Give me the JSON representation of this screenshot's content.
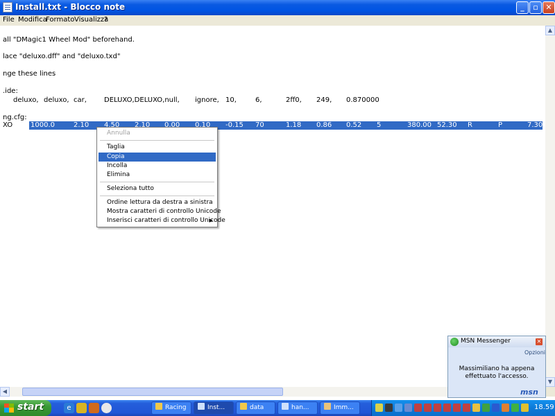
{
  "window": {
    "title": "Install.txt - Blocco note",
    "buttons": {
      "minimize": "_",
      "maximize": "▫",
      "close": "✕"
    }
  },
  "menubar": [
    "File",
    "Modifica",
    "Formato",
    "Visualizza",
    "?"
  ],
  "editor": {
    "lines": [
      "all \"DMagic1 Wheel Mod\" beforehand.",
      "lace \"deluxo.dff\" and \"deluxo.txd\"",
      "nge these lines",
      ".ide:",
      "ng.cfg:"
    ],
    "ide_row": [
      "deluxo,",
      "deluxo,",
      "car,",
      "DELUXO,DELUXO,null,",
      "ignore,",
      "10,",
      "6,",
      "2ff0,",
      "249,",
      "0.870000"
    ],
    "handling_prefix": "XO",
    "handling_row": [
      "1000.0",
      "2.10",
      "4.50",
      "2.10",
      "0.00",
      "0.10",
      "-0.15",
      "70",
      "1.18",
      "0.86",
      "0.52",
      "5",
      "380.00",
      "52.30",
      "R",
      "P",
      "7.30"
    ]
  },
  "context_menu": {
    "items": [
      {
        "label": "Annulla",
        "disabled": true
      },
      {
        "label": "Taglia"
      },
      {
        "label": "Copia",
        "selected": true
      },
      {
        "label": "Incolla"
      },
      {
        "label": "Elimina"
      },
      {
        "label": "Seleziona tutto"
      },
      {
        "label": "Ordine lettura da destra a sinistra"
      },
      {
        "label": "Mostra caratteri di controllo Unicode"
      },
      {
        "label": "Inserisci caratteri di controllo Unicode"
      }
    ],
    "submenu_arrow": "▶"
  },
  "msn": {
    "title": "MSN Messenger",
    "options": "Opzioni",
    "message": "Massimiliano ha appena effettuato l'accesso.",
    "logo": "msn"
  },
  "taskbar": {
    "start": "start",
    "tasks": [
      "Racing",
      "Inst...",
      "data",
      "han...",
      "Imm..."
    ],
    "clock": "18.59"
  },
  "colors": {
    "titlebar": "#0054e3",
    "selection": "#316ac5",
    "taskbar": "#245edb",
    "start": "#3a9a35"
  }
}
